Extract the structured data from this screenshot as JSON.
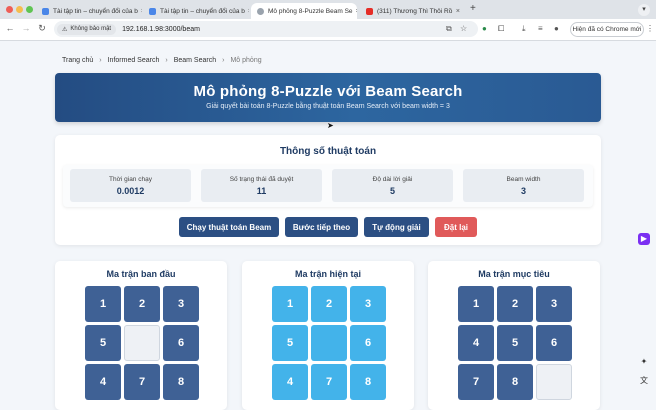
{
  "browser": {
    "tabs": [
      {
        "title": "Tài tập tin – chuyển đổi của b"
      },
      {
        "title": "Tài tập tin – chuyển đổi của b"
      },
      {
        "title": "Mô phỏng 8-Puzzle Beam Se"
      },
      {
        "title": "(311) Thương Thì Thôi Rồ"
      }
    ],
    "new_tab": "+",
    "security_label": "Không bảo mật",
    "url": "192.168.1.98:3000/beam",
    "profile_button": "Hiện đã có Chrome mới"
  },
  "breadcrumb": [
    "Trang chủ",
    "Informed Search",
    "Beam Search",
    "Mô phỏng"
  ],
  "banner": {
    "title": "Mô phỏng 8-Puzzle với Beam Search",
    "subtitle": "Giải quyết bài toán 8-Puzzle bằng thuật toán Beam Search với beam width = 3"
  },
  "params": {
    "heading": "Thông số thuật toán",
    "stats": [
      {
        "label": "Thời gian chạy",
        "value": "0.0012"
      },
      {
        "label": "Số trạng thái đã duyệt",
        "value": "11"
      },
      {
        "label": "Độ dài lời giải",
        "value": "5"
      },
      {
        "label": "Beam width",
        "value": "3"
      }
    ]
  },
  "buttons": {
    "run": "Chạy thuật toán Beam",
    "step": "Bước tiếp theo",
    "auto": "Tự động giải",
    "reset": "Đặt lại"
  },
  "boards": [
    {
      "title": "Ma trận ban đầu",
      "cells": [
        "1",
        "2",
        "3",
        "5",
        "",
        "6",
        "4",
        "7",
        "8"
      ]
    },
    {
      "title": "Ma trận hiện tại",
      "cells": [
        "1",
        "2",
        "3",
        "5",
        "",
        "6",
        "4",
        "7",
        "8"
      ]
    },
    {
      "title": "Ma trận mục tiêu",
      "cells": [
        "1",
        "2",
        "3",
        "4",
        "5",
        "6",
        "7",
        "8",
        ""
      ]
    }
  ],
  "colors": {
    "banner": "#2d66a0",
    "tile_dark": "#3f6195",
    "tile_light": "#43b3ea",
    "btn_primary": "#2c4f83",
    "btn_reset": "#e05a5a"
  }
}
